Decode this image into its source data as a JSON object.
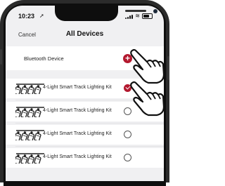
{
  "status_bar": {
    "time": "10:23",
    "location_icon": "location-arrow-icon"
  },
  "nav": {
    "cancel_label": "Cancel",
    "title": "All Devices"
  },
  "bluetooth": {
    "label": "Bluetooth Device",
    "add_icon": "plus-icon"
  },
  "devices": [
    {
      "label": "4-Light Smart Track Lighting Kit",
      "selected": true
    },
    {
      "label": "4-Light Smart Track Lighting Kit",
      "selected": false
    },
    {
      "label": "4-Light Smart Track Lighting Kit",
      "selected": false
    },
    {
      "label": "4-Light Smart Track Lighting Kit",
      "selected": false
    }
  ],
  "colors": {
    "accent": "#b3192f",
    "background": "#f0f0f2"
  }
}
